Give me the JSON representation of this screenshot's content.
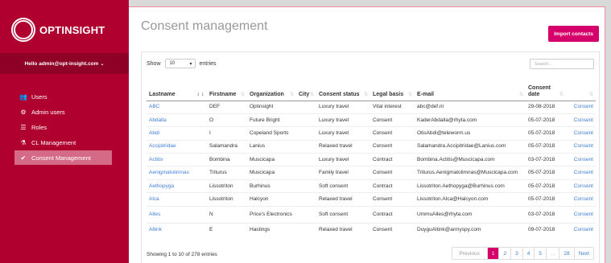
{
  "app": {
    "logo_text": "OPTINSIGHT",
    "user_greeting": "Hello admin@opt-insight.com"
  },
  "sidebar": {
    "items": [
      {
        "label": "Users",
        "icon": "users-icon",
        "glyph": "👥",
        "active": false
      },
      {
        "label": "Admin users",
        "icon": "admin-cogs-icon",
        "glyph": "⚙",
        "active": false
      },
      {
        "label": "Roles",
        "icon": "roles-icon",
        "glyph": "☰",
        "active": false
      },
      {
        "label": "CL Management",
        "icon": "flask-icon",
        "glyph": "⚗",
        "active": false
      },
      {
        "label": "Consent Management",
        "icon": "check-circle-icon",
        "glyph": "✔",
        "active": true
      }
    ]
  },
  "header": {
    "title": "Consent management",
    "import_label": "Import contacts"
  },
  "controls": {
    "show_label": "Show",
    "entries_label": "entries",
    "page_length": "10",
    "search_placeholder": "Search..."
  },
  "table": {
    "columns": [
      {
        "label": "Lastname",
        "width": 75
      },
      {
        "label": "Firstname",
        "width": 50
      },
      {
        "label": "Organization",
        "width": 61
      },
      {
        "label": "City",
        "width": 25
      },
      {
        "label": "Consent status",
        "width": 67
      },
      {
        "label": "Legal basis",
        "width": 55
      },
      {
        "label": "E-mail",
        "width": 138
      },
      {
        "label": "Consent date",
        "width": 50
      },
      {
        "label": "",
        "width": 37
      }
    ],
    "rows": [
      [
        "ABC",
        "DEF",
        "Optinsight",
        "",
        "Luxury travel",
        "Vital interest",
        "abc@def.nl",
        "29-08-2018",
        "Consent"
      ],
      [
        "Abdalla",
        "O",
        "Future Bright",
        "",
        "Luxury travel",
        "Consent",
        "KaderAbdalla@rhyta.com",
        "05-07-2018",
        "Consent"
      ],
      [
        "Abdi",
        "I",
        "Copeland Sports",
        "",
        "Luxury travel",
        "Consent",
        "OtisAbdi@teleworm.us",
        "05-07-2018",
        "Consent"
      ],
      [
        "Accipitridae",
        "Salamandra",
        "Lanius",
        "",
        "Relaxed travel",
        "Consent",
        "Salamandra.Accipitridae@Lanius.com",
        "05-07-2018",
        "Consent"
      ],
      [
        "Actitis",
        "Bombina",
        "Muscicapa",
        "",
        "Luxury travel",
        "Contract",
        "Bombina.Actitis@Muscicapa.com",
        "03-07-2018",
        "Consent"
      ],
      [
        "Aenigmatolimnas",
        "Triturus",
        "Muscicapa",
        "",
        "Family travel",
        "Consent",
        "Triturus.Aenigmatolimnas@Muscicapa.com",
        "05-07-2018",
        "Consent"
      ],
      [
        "Aethopyga",
        "Lissotriton",
        "Burhinus",
        "",
        "Soft consent",
        "Contract",
        "Lissotriton.Aethopyga@Burhinus.com",
        "05-07-2018",
        "Consent"
      ],
      [
        "Alca",
        "Lissotriton",
        "Halcyon",
        "",
        "Relaxed travel",
        "Consent",
        "Lissotriton.Alca@Halcyon.com",
        "05-07-2018",
        "Consent"
      ],
      [
        "Alles",
        "N",
        "Price's Electronics",
        "",
        "Soft consent",
        "Contract",
        "UmmuAlles@rhyta.com",
        "03-07-2018",
        "Consent"
      ],
      [
        "Altink",
        "E",
        "Hastings",
        "",
        "Relaxed travel",
        "Consent",
        "DuyguAltink@armyspy.com",
        "09-07-2018",
        "Consent"
      ]
    ]
  },
  "footer": {
    "info": "Showing 1 to 10 of 278 entries",
    "pager": [
      "Previous",
      "1",
      "2",
      "3",
      "4",
      "5",
      "...",
      "28",
      "Next"
    ],
    "current_page": "1"
  },
  "colors": {
    "brand": "#b0002f",
    "accent": "#d6006a",
    "link": "#3f7fd6"
  }
}
